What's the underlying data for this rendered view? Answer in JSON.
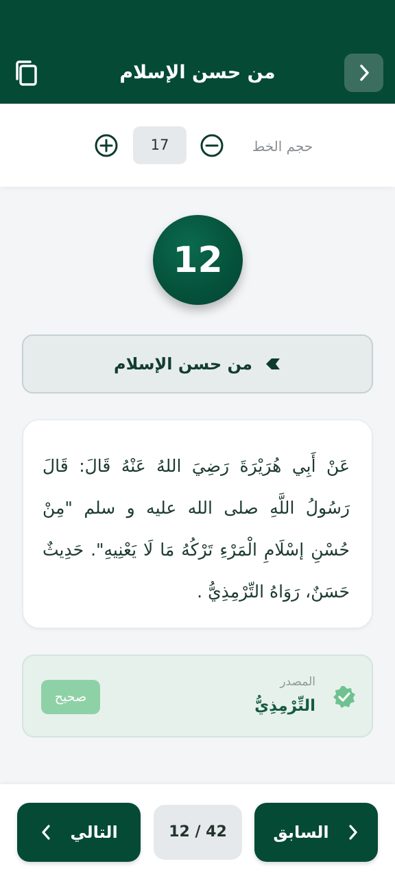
{
  "header": {
    "title": "من حسن الإسلام"
  },
  "font_controls": {
    "label": "حجم الخط",
    "value": "17"
  },
  "hadith": {
    "number": "12",
    "title": "من حسن الإسلام",
    "text": "عَنْ أَبِي هُرَيْرَةَ رَضِيَ اللهُ عَنْهُ قَالَ: قَالَ رَسُولُ اللَّهِ صلى الله عليه و سلم \"مِنْ حُسْنِ إسْلَامِ الْمَرْءِ تَرْكُهُ مَا لَا يَعْنِيهِ\". حَدِيثٌ حَسَنٌ، رَوَاهُ التِّرْمِذِيُّ ."
  },
  "source": {
    "label": "المصدر",
    "name": "التِّرْمِذِيُّ",
    "grade": "صحيح"
  },
  "navigation": {
    "next_label": "التالي",
    "prev_label": "السابق",
    "page_indicator": "12 / 42"
  },
  "icons": {
    "back": "chevron-right-icon",
    "copy": "copy-icon",
    "increase": "plus-circle-icon",
    "decrease": "minus-circle-icon",
    "verified": "verified-check-icon"
  },
  "colors": {
    "primary": "#044a35",
    "accent_green": "#8fd1a6",
    "background": "#f3f5f7"
  }
}
